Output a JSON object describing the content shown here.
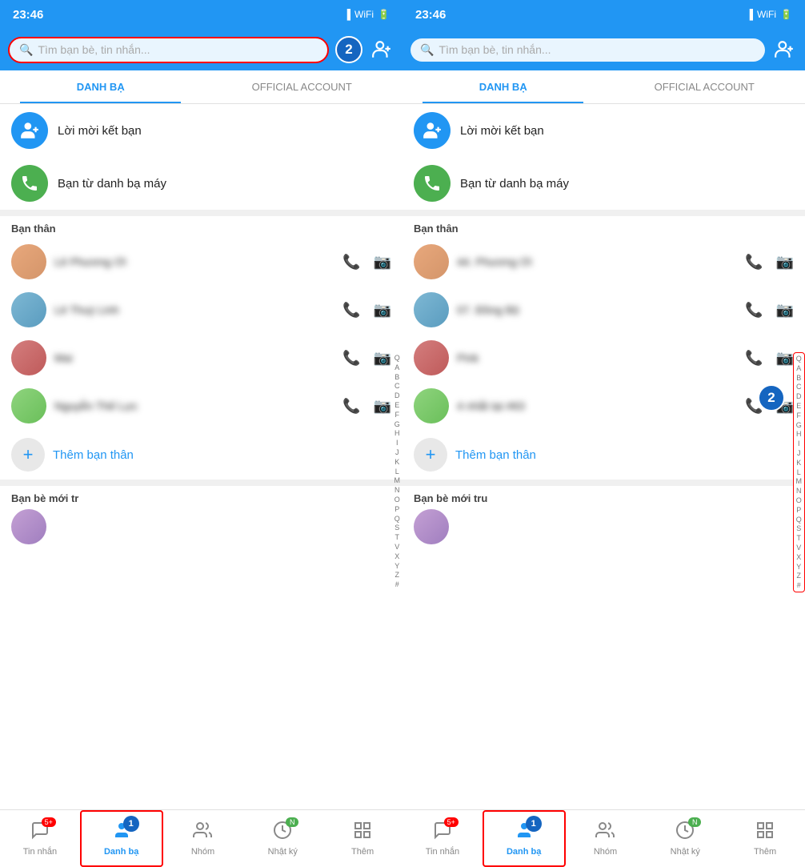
{
  "left_panel": {
    "status_time": "23:46",
    "search_placeholder": "Tìm bạn bè, tin nhắn...",
    "badge_number": "2",
    "tabs": [
      {
        "id": "danh-ba",
        "label": "DANH BẠ",
        "active": true
      },
      {
        "id": "official-account",
        "label": "OFFICIAL ACCOUNT",
        "active": false
      }
    ],
    "friend_invite": "Lời mời kết bạn",
    "phone_contacts": "Bạn từ danh bạ máy",
    "section_best_friends": "Bạn thân",
    "contacts": [
      {
        "id": "c1",
        "name": "Lê Phương Ơi",
        "avatar_class": "avatar-1"
      },
      {
        "id": "c2",
        "name": "Lê Thuỳ Linh",
        "avatar_class": "avatar-2"
      },
      {
        "id": "c3",
        "name": "Mai",
        "avatar_class": "avatar-3"
      },
      {
        "id": "c4",
        "name": "Nguyễn Thế Lực",
        "avatar_class": "avatar-4"
      }
    ],
    "add_best_friend": "Thêm bạn thân",
    "section_new_friends": "Bạn bè mới tr",
    "alphabet": [
      "Q",
      "A",
      "B",
      "C",
      "D",
      "E",
      "F",
      "G",
      "H",
      "I",
      "J",
      "K",
      "L",
      "M",
      "N",
      "O",
      "P",
      "Q",
      "S",
      "T",
      "V",
      "X",
      "Y",
      "Z",
      "#"
    ],
    "bottom_nav": [
      {
        "id": "messages",
        "label": "Tin nhắn",
        "icon": "💬",
        "badge": "5+",
        "active": false
      },
      {
        "id": "contacts",
        "label": "Danh bạ",
        "icon": "👤",
        "badge": "",
        "active": true
      },
      {
        "id": "groups",
        "label": "Nhóm",
        "icon": "👥",
        "badge": "",
        "active": false
      },
      {
        "id": "diary",
        "label": "Nhật ký",
        "icon": "🕐",
        "badge": "N",
        "active": false
      },
      {
        "id": "more",
        "label": "Thêm",
        "icon": "⊞",
        "badge": "",
        "active": false
      }
    ],
    "badge_nav": "1",
    "search_highlighted": true
  },
  "right_panel": {
    "status_time": "23:46",
    "search_placeholder": "Tìm bạn bè, tin nhắn...",
    "badge_number": "2",
    "tabs": [
      {
        "id": "danh-ba",
        "label": "DANH BẠ",
        "active": true
      },
      {
        "id": "official-account",
        "label": "OFFICIAL ACCOUNT",
        "active": false
      }
    ],
    "friend_invite": "Lời mời kết bạn",
    "phone_contacts": "Bạn từ danh bạ máy",
    "section_best_friends": "Bạn thân",
    "contacts": [
      {
        "id": "c1",
        "name": "44. Phương Ơi",
        "avatar_class": "avatar-1"
      },
      {
        "id": "c2",
        "name": "07. Đồng Bộ",
        "avatar_class": "avatar-2"
      },
      {
        "id": "c3",
        "name": "Pink",
        "avatar_class": "avatar-3"
      },
      {
        "id": "c4",
        "name": "4 nhắt tại #63",
        "avatar_class": "avatar-4"
      }
    ],
    "add_best_friend": "Thêm bạn thân",
    "section_new_friends": "Bạn bè mới tru",
    "alphabet": [
      "Q",
      "A",
      "B",
      "C",
      "D",
      "E",
      "F",
      "G",
      "H",
      "I",
      "J",
      "K",
      "L",
      "M",
      "N",
      "O",
      "P",
      "Q",
      "S",
      "T",
      "V",
      "X",
      "Y",
      "Z",
      "#"
    ],
    "bottom_nav": [
      {
        "id": "messages",
        "label": "Tin nhắn",
        "icon": "💬",
        "badge": "5+",
        "active": false
      },
      {
        "id": "contacts",
        "label": "Danh bạ",
        "icon": "👤",
        "badge": "",
        "active": true
      },
      {
        "id": "groups",
        "label": "Nhóm",
        "icon": "👥",
        "badge": "",
        "active": false
      },
      {
        "id": "diary",
        "label": "Nhật ký",
        "icon": "🕐",
        "badge": "N",
        "active": false
      },
      {
        "id": "more",
        "label": "Thêm",
        "icon": "⊞",
        "badge": "",
        "active": false
      }
    ],
    "badge_nav": "1",
    "alpha_highlighted": true
  }
}
